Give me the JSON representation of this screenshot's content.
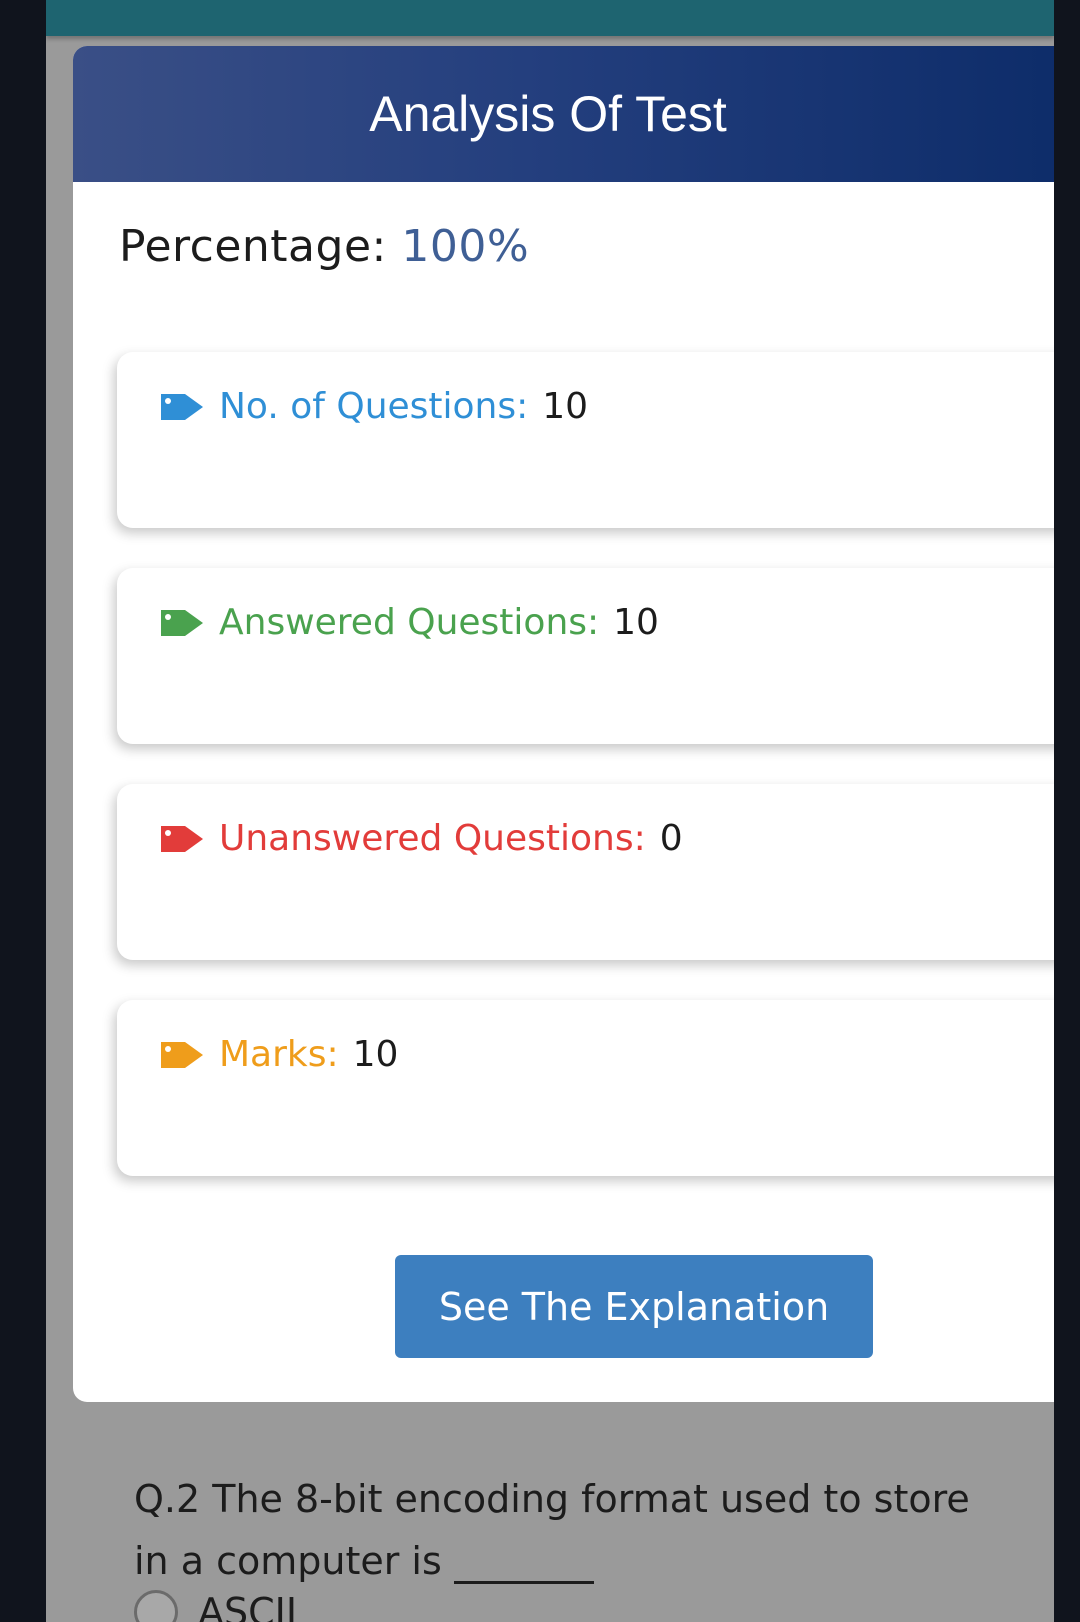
{
  "header": {
    "title": "Analysis Of Test"
  },
  "summary": {
    "percentage_label": "Percentage:",
    "percentage_value": "100%"
  },
  "stats": [
    {
      "label": "No. of Questions:",
      "value": "10",
      "color": "#2f8fd6",
      "icon": "tag-icon"
    },
    {
      "label": "Answered Questions:",
      "value": "10",
      "color": "#4aa24e",
      "icon": "tag-icon"
    },
    {
      "label": "Unanswered Questions:",
      "value": "0",
      "color": "#e23c3a",
      "icon": "tag-icon"
    },
    {
      "label": "Marks:",
      "value": "10",
      "color": "#ef9d1b",
      "icon": "tag-icon"
    }
  ],
  "actions": {
    "explanation_label": "See The Explanation"
  },
  "question": {
    "line1": "Q.2 The 8-bit encoding format used to store",
    "line2": "in a computer is",
    "option1": "ASCII"
  },
  "colors": {
    "header_start": "#3a4f86",
    "header_end": "#0d2c69",
    "button": "#3d7fbf",
    "percentage_value": "#3f5f95"
  }
}
